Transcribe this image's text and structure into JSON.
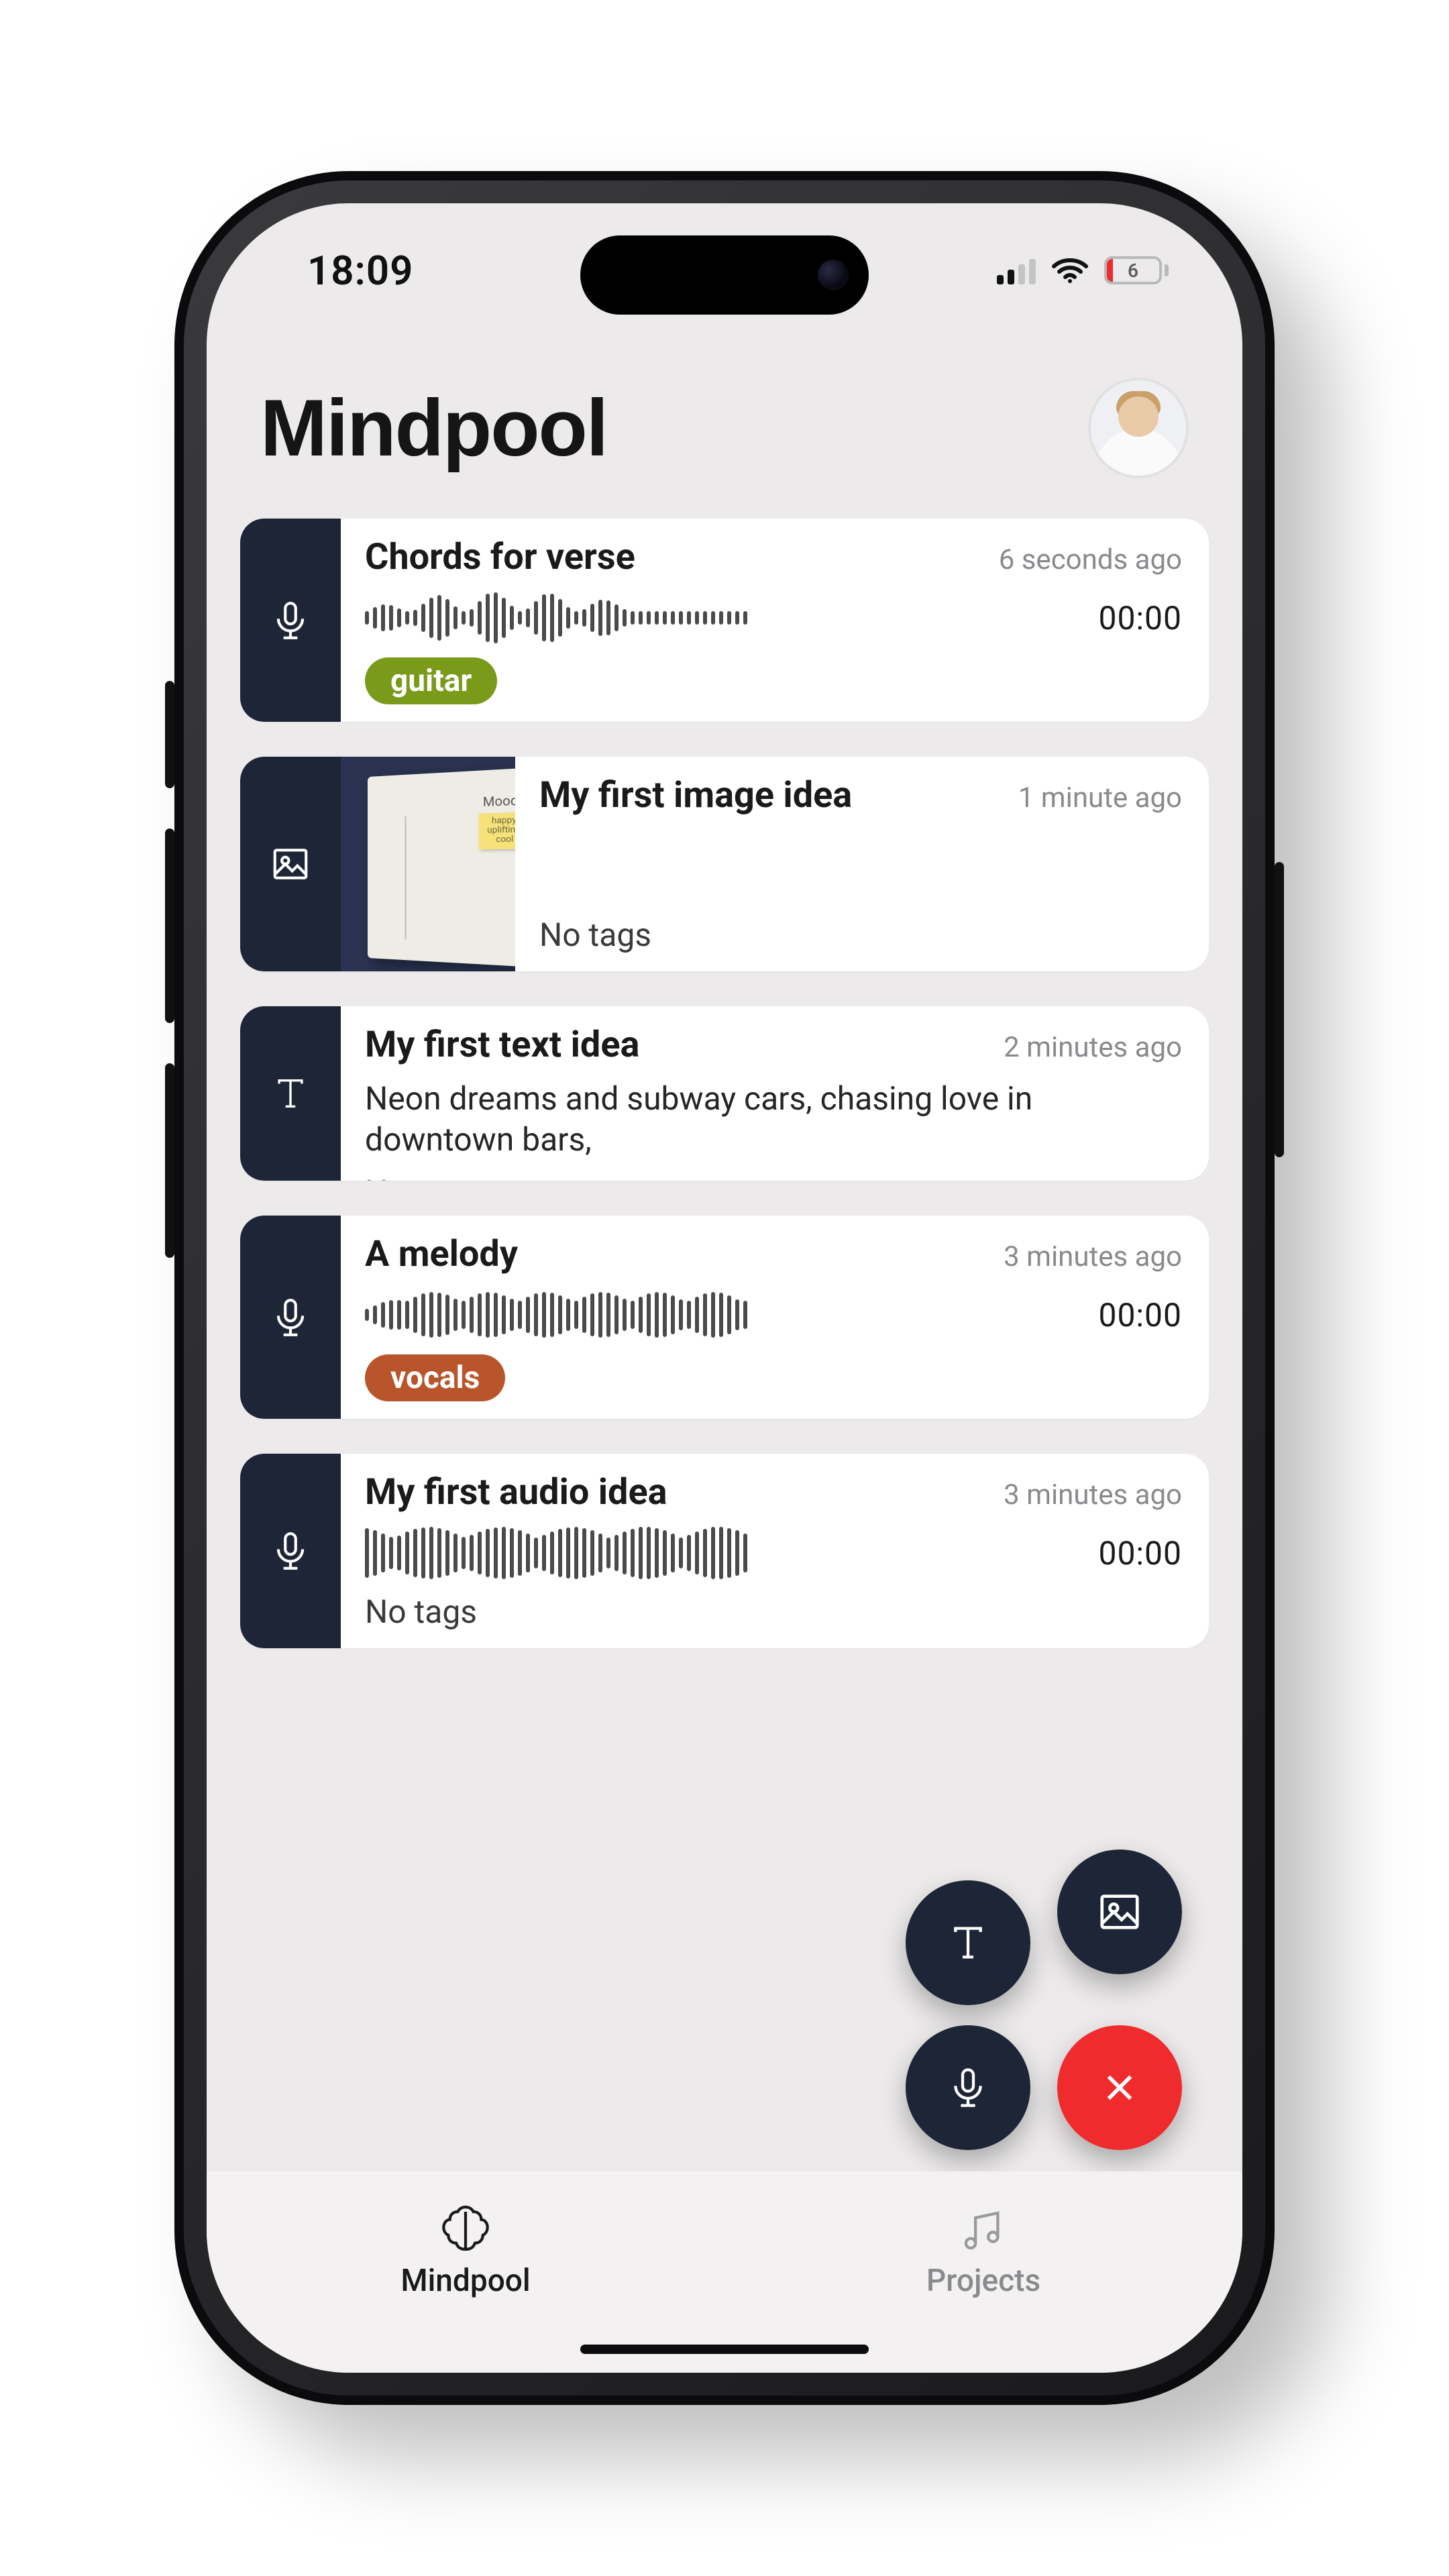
{
  "status": {
    "time": "18:09",
    "battery_percent": "6"
  },
  "header": {
    "title": "Mindpool"
  },
  "ideas": [
    {
      "kind": "audio",
      "title": "Chords for verse",
      "timestamp": "6 seconds ago",
      "duration": "00:00",
      "tags": [
        {
          "label": "guitar",
          "color": "green"
        }
      ],
      "no_tags_label": ""
    },
    {
      "kind": "image",
      "title": "My first image idea",
      "timestamp": "1 minute ago",
      "thumb_caption_1": "Mood:",
      "thumb_caption_2": "happy, uplifting, cool",
      "no_tags_label": "No tags"
    },
    {
      "kind": "text",
      "title": "My first text idea",
      "timestamp": "2 minutes ago",
      "snippet": "Neon dreams and subway cars, chasing love in downtown bars,",
      "no_tags_label": "No tags"
    },
    {
      "kind": "audio",
      "title": "A melody",
      "timestamp": "3 minutes ago",
      "duration": "00:00",
      "tags": [
        {
          "label": "vocals",
          "color": "orange"
        }
      ],
      "no_tags_label": ""
    },
    {
      "kind": "audio",
      "title": "My first audio idea",
      "timestamp": "3 minutes ago",
      "duration": "00:00",
      "tags": [],
      "no_tags_label": "No tags"
    }
  ],
  "fab": {
    "text_label": "new-text-idea",
    "image_label": "new-image-idea",
    "audio_label": "new-audio-idea",
    "close_label": "close-fab"
  },
  "tabs": {
    "mindpool": "Mindpool",
    "projects": "Projects"
  },
  "colors": {
    "card_side": "#1d2536",
    "accent_red": "#ef2b2d",
    "tag_green": "#7a9a1a",
    "tag_orange": "#b8552a",
    "bg": "#eceaea"
  }
}
